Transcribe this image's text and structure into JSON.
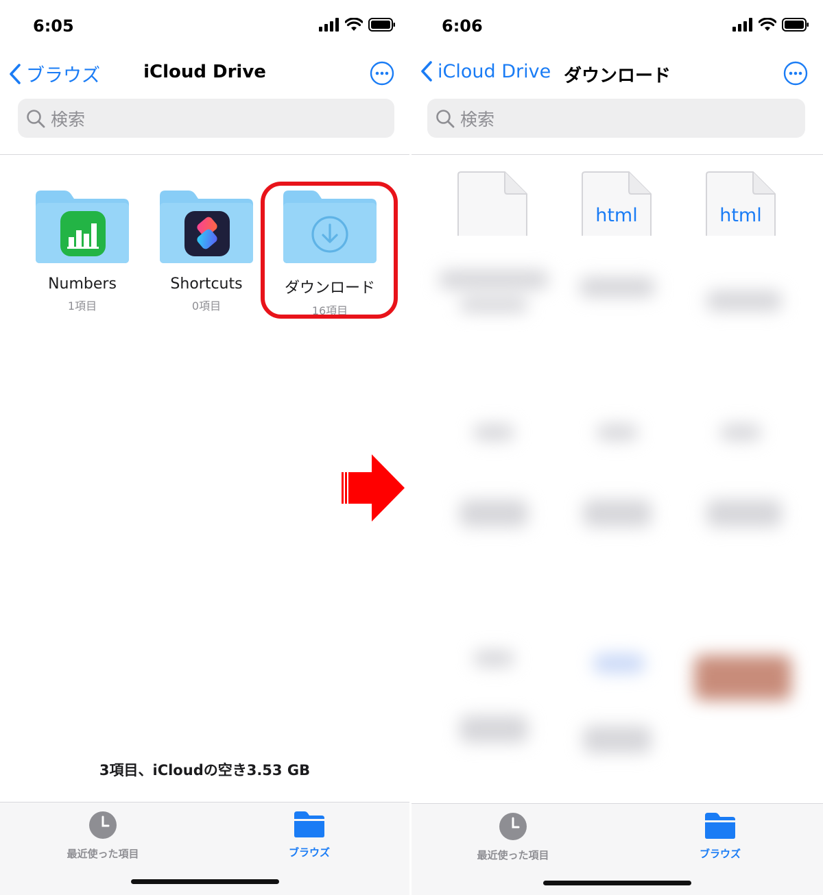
{
  "left": {
    "status_time": "6:05",
    "back_label": "ブラウズ",
    "title": "iCloud Drive",
    "search_placeholder": "検索",
    "folders": [
      {
        "name": "Numbers",
        "count": "1項目"
      },
      {
        "name": "Shortcuts",
        "count": "0項目"
      },
      {
        "name": "ダウンロード",
        "count": "16項目"
      }
    ],
    "footer_info": "3項目、iCloudの空き3.53 GB",
    "tabs": {
      "recent": "最近使った項目",
      "browse": "ブラウズ"
    }
  },
  "right": {
    "status_time": "6:06",
    "back_label": "iCloud Drive",
    "title": "ダウンロード",
    "search_placeholder": "検索",
    "files": [
      {
        "type": ""
      },
      {
        "type": "html"
      },
      {
        "type": "html"
      }
    ],
    "tabs": {
      "recent": "最近使った項目",
      "browse": "ブラウズ"
    }
  },
  "colors": {
    "accent": "#1a7cf5",
    "highlight": "#e8131a",
    "folder": "#88cdf6",
    "arrow": "#ff0000"
  },
  "icons": {
    "back": "chevron-left-icon",
    "more": "ellipsis-circle-icon",
    "search": "magnifier-icon",
    "recent": "clock-icon",
    "browse": "folder-icon"
  }
}
